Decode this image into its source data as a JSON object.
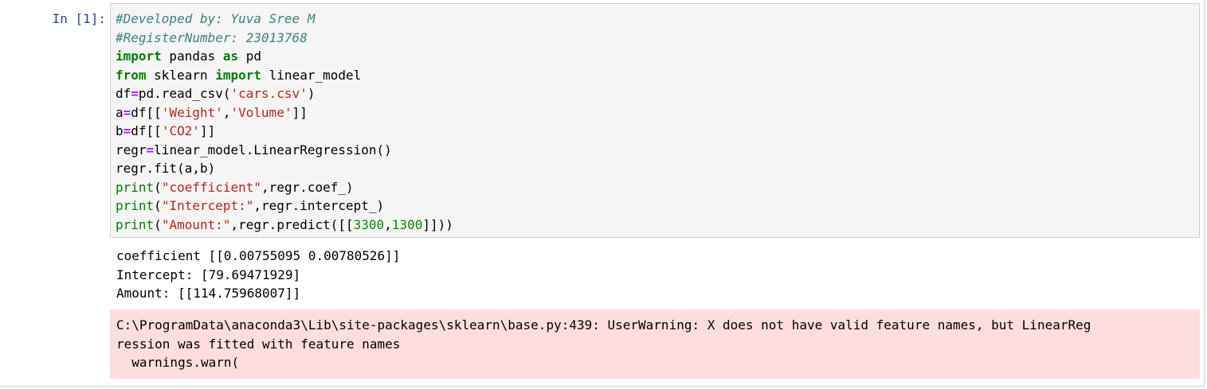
{
  "cell": {
    "prompt": "In [1]:",
    "code": {
      "comment1": "#Developed by: Yuva Sree M",
      "comment2": "#RegisterNumber: 23013768",
      "line3": {
        "kw1": "import",
        "mid": " pandas ",
        "kw2": "as",
        "end": " pd"
      },
      "line4": {
        "kw1": "from",
        "mid": " sklearn ",
        "kw2": "import",
        "end": " linear_model"
      },
      "line5": {
        "a": "df",
        "op": "=",
        "b": "pd.read_csv(",
        "str": "'cars.csv'",
        "c": ")"
      },
      "line6": {
        "a": "a",
        "op": "=",
        "b": "df[[",
        "s1": "'Weight'",
        "comma": ",",
        "s2": "'Volume'",
        "c": "]]"
      },
      "line7": {
        "a": "b",
        "op": "=",
        "b": "df[[",
        "s1": "'CO2'",
        "c": "]]"
      },
      "line8": {
        "a": "regr",
        "op": "=",
        "b": "linear_model.LinearRegression()"
      },
      "line9": "regr.fit(a,b)",
      "line10": {
        "fn": "print",
        "a": "(",
        "str": "\"coefficient\"",
        "b": ",regr.coef_)"
      },
      "line11": {
        "fn": "print",
        "a": "(",
        "str": "\"Intercept:\"",
        "b": ",regr.intercept_)"
      },
      "line12": {
        "fn": "print",
        "a": "(",
        "str": "\"Amount:\"",
        "b": ",regr.predict([[",
        "n1": "3300",
        "comma": ",",
        "n2": "1300",
        "c": "]]))"
      }
    },
    "output": {
      "line1": "coefficient [[0.00755095 0.00780526]]",
      "line2": "Intercept: [79.69471929]",
      "line3": "Amount: [[114.75968007]]"
    },
    "stderr": {
      "line1": "C:\\ProgramData\\anaconda3\\Lib\\site-packages\\sklearn\\base.py:439: UserWarning: X does not have valid feature names, but LinearReg",
      "line2": "ression was fitted with feature names",
      "line3": "  warnings.warn("
    }
  },
  "colors": {
    "prompt": "#303f9f",
    "comment": "#408080",
    "keyword": "#008000",
    "string": "#ba2121",
    "operator": "#aa22ff",
    "stderr_bg": "#ffdddd",
    "input_bg": "#f5f5f5"
  }
}
